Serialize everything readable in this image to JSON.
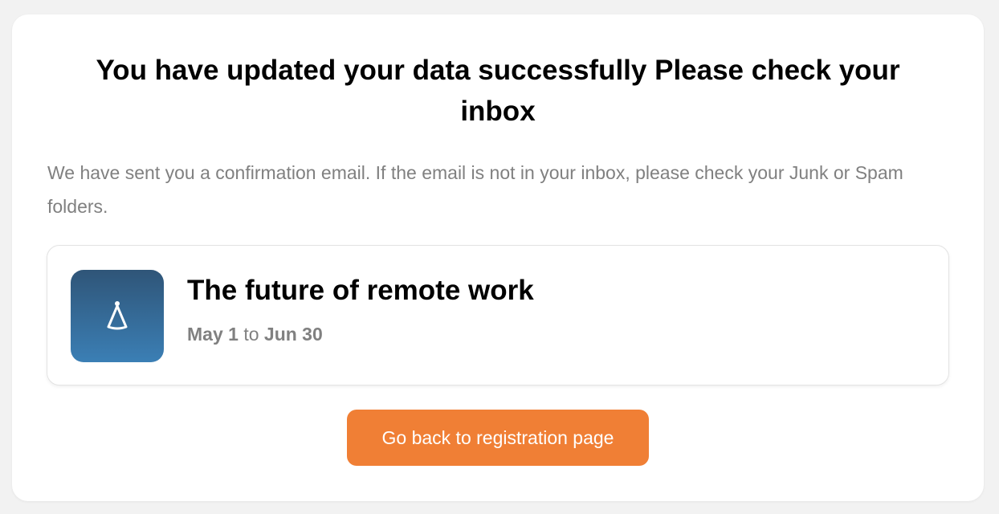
{
  "confirmation": {
    "title": "You have updated your data successfully Please check your inbox",
    "message": "We have sent you a confirmation email. If the email is not in your inbox, please check your Junk or Spam folders."
  },
  "event": {
    "icon": "party-hat-icon",
    "icon_gradient": [
      "#2f5578",
      "#3b7fb5"
    ],
    "title": "The future of remote work",
    "start_date": "May 1",
    "date_separator": "to",
    "end_date": "Jun 30"
  },
  "actions": {
    "back_label": "Go back to registration page",
    "back_color": "#f07f35"
  }
}
